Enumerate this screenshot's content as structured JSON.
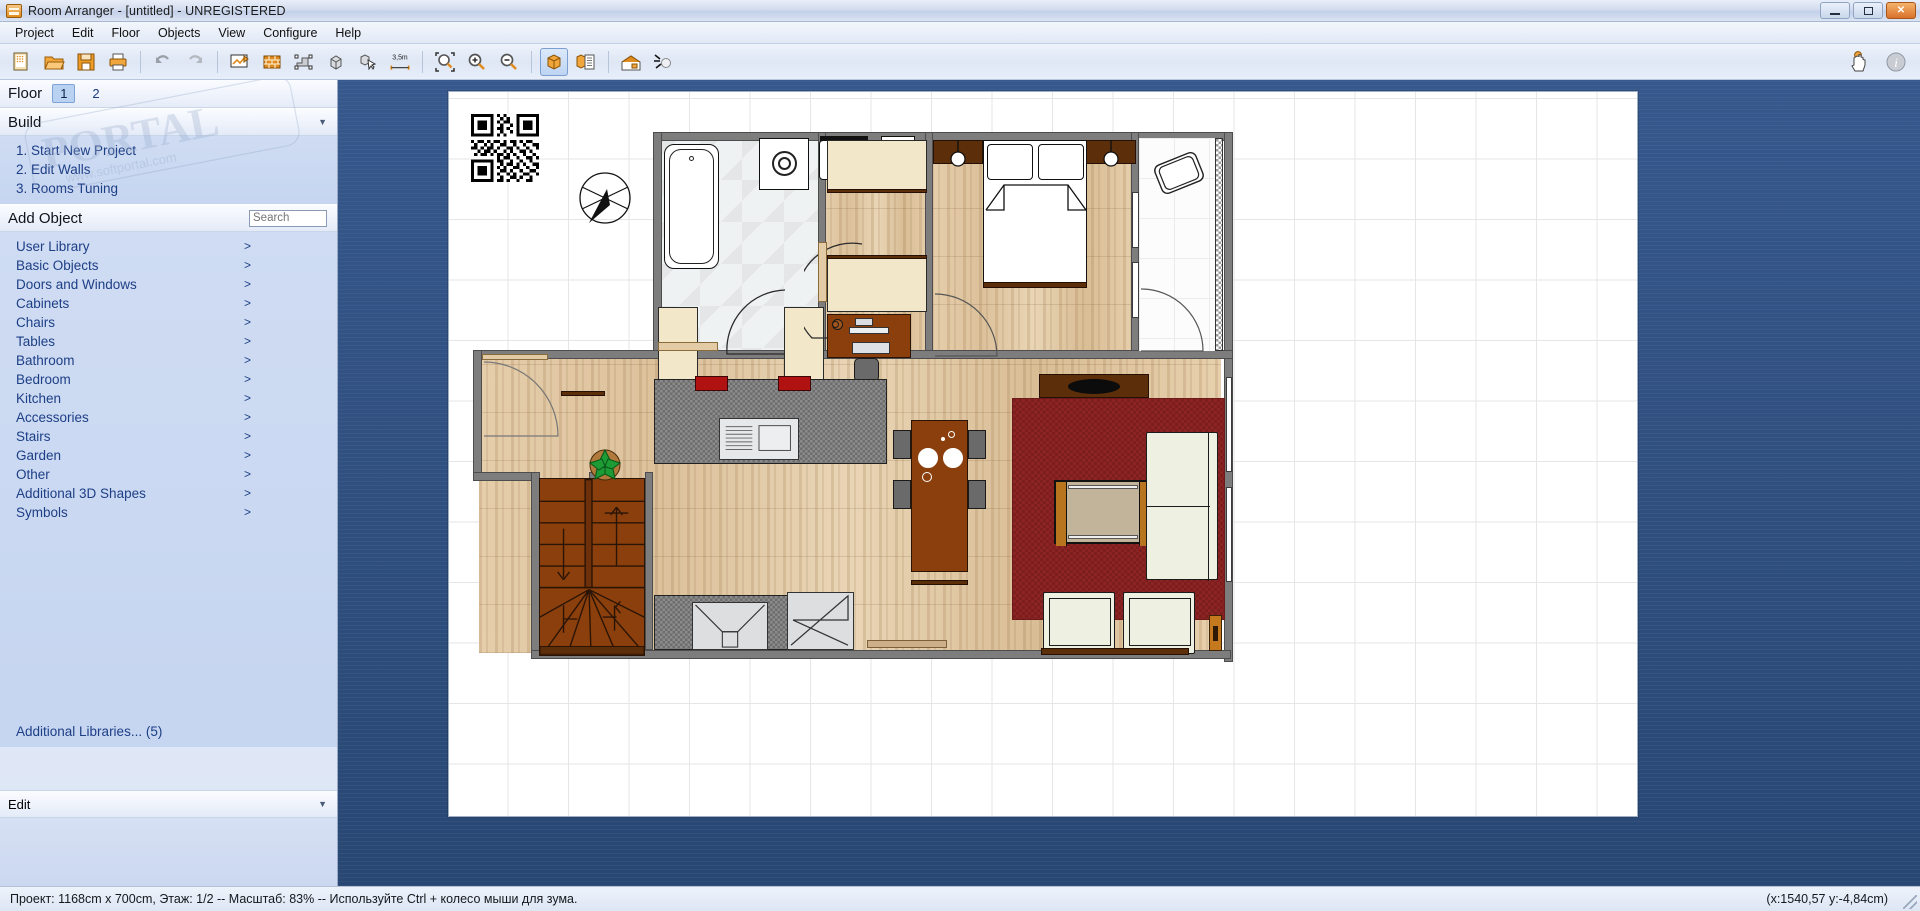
{
  "window": {
    "title": "Room Arranger - [untitled] - UNREGISTERED",
    "app_icon": "room-icon",
    "minimize_label": "",
    "restore_label": "",
    "close_label": "✕"
  },
  "menu": {
    "items": [
      {
        "label": "Project"
      },
      {
        "label": "Edit"
      },
      {
        "label": "Floor"
      },
      {
        "label": "Objects"
      },
      {
        "label": "View"
      },
      {
        "label": "Configure"
      },
      {
        "label": "Help"
      }
    ]
  },
  "toolbar": {
    "buttons": [
      {
        "name": "new-project-icon",
        "label": "",
        "selected": false
      },
      {
        "name": "open-project-icon",
        "label": "",
        "selected": false
      },
      {
        "name": "save-project-icon",
        "label": "",
        "selected": false
      },
      {
        "name": "print-icon",
        "label": "",
        "selected": false
      },
      {
        "name": "undo-icon",
        "label": "",
        "selected": false
      },
      {
        "name": "redo-icon",
        "label": "",
        "selected": false
      },
      {
        "name": "edit-walls-icon",
        "label": "",
        "selected": false
      },
      {
        "name": "brick-wall-icon",
        "label": "",
        "selected": false
      },
      {
        "name": "rooms-tuning-icon",
        "label": "",
        "selected": false
      },
      {
        "name": "object-3d-icon",
        "label": "",
        "selected": false
      },
      {
        "name": "select-object-icon",
        "label": "",
        "selected": false
      },
      {
        "name": "measure-icon",
        "label": "3,5m",
        "selected": false
      },
      {
        "name": "zoom-fit-icon",
        "label": "",
        "selected": false
      },
      {
        "name": "zoom-in-icon",
        "label": "",
        "selected": false
      },
      {
        "name": "zoom-out-icon",
        "label": "",
        "selected": false
      },
      {
        "name": "view-3d-icon",
        "label": "",
        "selected": true
      },
      {
        "name": "object-list-icon",
        "label": "",
        "selected": false
      },
      {
        "name": "house-view-icon",
        "label": "",
        "selected": false
      },
      {
        "name": "light-icon",
        "label": "",
        "selected": false
      }
    ],
    "right_buttons": [
      {
        "name": "hand-pointer-icon",
        "label": ""
      },
      {
        "name": "info-icon",
        "label": "i"
      }
    ],
    "measure_label": "3,5m"
  },
  "sidebar": {
    "floor": {
      "label": "Floor",
      "options": [
        {
          "label": "1",
          "active": true
        },
        {
          "label": "2",
          "active": false
        }
      ]
    },
    "build": {
      "title": "Build",
      "caret": "▼",
      "items": [
        {
          "label": "1. Start New Project"
        },
        {
          "label": "2. Edit Walls"
        },
        {
          "label": "3. Rooms Tuning"
        }
      ]
    },
    "add_object": {
      "title": "Add Object",
      "search_placeholder": "Search",
      "search_value": "",
      "arrow": ">",
      "libraries": [
        {
          "label": "User Library"
        },
        {
          "label": "Basic Objects"
        },
        {
          "label": "Doors and Windows"
        },
        {
          "label": "Cabinets"
        },
        {
          "label": "Chairs"
        },
        {
          "label": "Tables"
        },
        {
          "label": "Bathroom"
        },
        {
          "label": "Bedroom"
        },
        {
          "label": "Kitchen"
        },
        {
          "label": "Accessories"
        },
        {
          "label": "Stairs"
        },
        {
          "label": "Garden"
        },
        {
          "label": "Other"
        },
        {
          "label": "Additional 3D Shapes"
        },
        {
          "label": "Symbols"
        }
      ],
      "additional_libraries": "Additional Libraries... (5)"
    },
    "edit": {
      "title": "Edit",
      "caret": "▼"
    },
    "watermark": "www.softportal.com"
  },
  "canvas": {
    "qr_code": "qr-code",
    "compass": "compass-rose",
    "nav_arrow": "play-arrow"
  },
  "status": {
    "left": "Проект: 1168cm x 700cm, Этаж: 1/2 -- Масштаб: 83% -- Используйте Ctrl + колесо мыши для зума.",
    "right": "(x:1540,57 y:-4,84cm)"
  },
  "floorplan": {
    "project_width_cm": 1168,
    "project_height_cm": 700,
    "floor": "1/2",
    "scale_percent": 83,
    "rooms": [
      {
        "name": "bathroom",
        "floor": "tile"
      },
      {
        "name": "bedroom",
        "floor": "wood"
      },
      {
        "name": "hallway",
        "floor": "wood"
      },
      {
        "name": "living-room",
        "floor": "wood"
      },
      {
        "name": "kitchen",
        "floor": "wood"
      },
      {
        "name": "balcony",
        "floor": "plain"
      }
    ],
    "objects": [
      {
        "name": "bathtub"
      },
      {
        "name": "shower"
      },
      {
        "name": "washbasin"
      },
      {
        "name": "toilet"
      },
      {
        "name": "bathroom-cabinet-left"
      },
      {
        "name": "bathroom-cabinet-right"
      },
      {
        "name": "double-bed"
      },
      {
        "name": "nightstand-left"
      },
      {
        "name": "nightstand-right"
      },
      {
        "name": "desk"
      },
      {
        "name": "office-chair"
      },
      {
        "name": "monitor"
      },
      {
        "name": "keyboard"
      },
      {
        "name": "wardrobe-top"
      },
      {
        "name": "wardrobe-bottom"
      },
      {
        "name": "dresser"
      },
      {
        "name": "kitchen-counter"
      },
      {
        "name": "cooktop"
      },
      {
        "name": "kitchen-sink"
      },
      {
        "name": "dishwasher"
      },
      {
        "name": "dining-table"
      },
      {
        "name": "dining-chair"
      },
      {
        "name": "living-rug"
      },
      {
        "name": "coffee-table"
      },
      {
        "name": "sofa"
      },
      {
        "name": "armchair-left"
      },
      {
        "name": "armchair-right"
      },
      {
        "name": "staircase"
      },
      {
        "name": "plant"
      },
      {
        "name": "balcony-table"
      }
    ]
  },
  "colors": {
    "accent": "#1d3f86",
    "desk_background": "#36588c",
    "panel": "#cfdcf3",
    "wall": "#7d7d7d",
    "wood_floor": "#e0c49f",
    "rug_red": "#8d2424",
    "brown_furniture": "#8a3f0c",
    "close_button": "#d8722c"
  }
}
